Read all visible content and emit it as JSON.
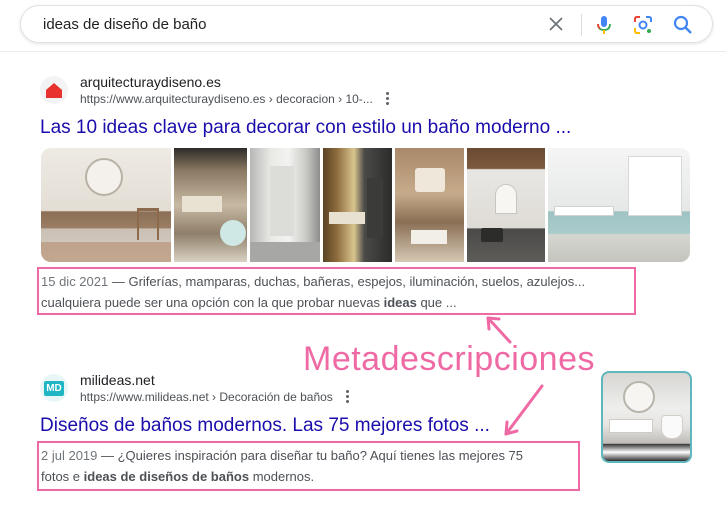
{
  "search": {
    "query": "ideas de diseño de baño"
  },
  "results": [
    {
      "site_name": "arquitecturaydiseno.es",
      "url": "https://www.arquitecturaydiseno.es › decoracion › 10-...",
      "title": "Las 10 ideas clave para decorar con estilo un baño moderno ...",
      "date": "15 dic 2021",
      "snippet_line1": " — Griferías, mamparas, duchas, bañeras, espejos, iluminación, suelos, azulejos...",
      "snippet_line2_pre": "cualquiera puede ser una opción con la que probar nuevas ",
      "snippet_line2_bold": "ideas",
      "snippet_line2_post": " que ..."
    },
    {
      "site_name": "milideas.net",
      "url": "https://www.milideas.net › Decoración de baños",
      "title": "Diseños de baños modernos. Las 75 mejores fotos ...",
      "favicon_text": "MD",
      "date": "2 jul 2019",
      "snippet_line1": " — ¿Quieres inspiración para diseñar tu baño? Aquí tienes las mejores 75",
      "snippet_line2_pre": "fotos e ",
      "snippet_line2_bold": "ideas de diseños de baños",
      "snippet_line2_post": " modernos."
    }
  ],
  "annotation": {
    "label": "Metadescripciones",
    "color": "#ef6aa4"
  },
  "colors": {
    "link": "#1a0dab",
    "favicon_1": "#e8322d",
    "favicon_2": "#1fb5c3"
  }
}
